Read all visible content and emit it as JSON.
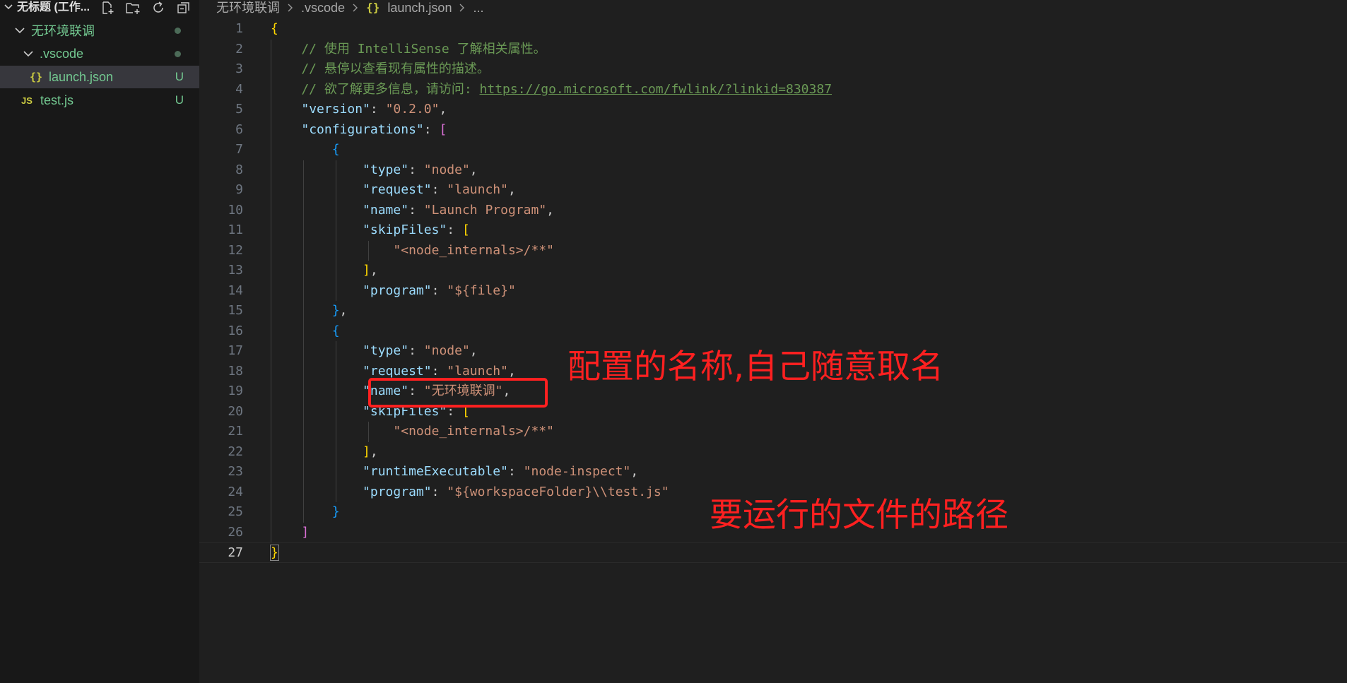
{
  "explorer": {
    "workspace_title": "无标题 (工作...",
    "actions": [
      "new-file-icon",
      "new-folder-icon",
      "refresh-icon",
      "collapse-all-icon"
    ],
    "items": [
      {
        "label": "无环境联调",
        "type": "folder",
        "status": "dot"
      },
      {
        "label": ".vscode",
        "type": "folder",
        "status": "dot"
      },
      {
        "label": "launch.json",
        "type": "json",
        "icon_text": "{}",
        "status": "U"
      },
      {
        "label": "test.js",
        "type": "js",
        "icon_text": "JS",
        "status": "U"
      }
    ]
  },
  "breadcrumb": {
    "items": [
      "无环境联调",
      ".vscode",
      "launch.json",
      "..."
    ],
    "json_icon": "{}"
  },
  "editor": {
    "active_line": 27,
    "line_numbers": [
      "1",
      "2",
      "3",
      "4",
      "5",
      "6",
      "7",
      "8",
      "9",
      "10",
      "11",
      "12",
      "13",
      "14",
      "15",
      "16",
      "17",
      "18",
      "19",
      "20",
      "21",
      "22",
      "23",
      "24",
      "25",
      "26",
      "27"
    ],
    "lines": [
      [
        [
          "br1",
          "{"
        ]
      ],
      [
        [
          "t-comment",
          "    // 使用 IntelliSense 了解相关属性。"
        ]
      ],
      [
        [
          "t-comment",
          "    // 悬停以查看现有属性的描述。"
        ]
      ],
      [
        [
          "t-comment",
          "    // 欲了解更多信息，请访问: "
        ],
        [
          "t-link",
          "https://go.microsoft.com/fwlink/?linkid=830387"
        ]
      ],
      [
        [
          "t-p",
          "    "
        ],
        [
          "t-key",
          "\"version\""
        ],
        [
          "t-p",
          ": "
        ],
        [
          "t-str",
          "\"0.2.0\""
        ],
        [
          "t-p",
          ","
        ]
      ],
      [
        [
          "t-p",
          "    "
        ],
        [
          "t-key",
          "\"configurations\""
        ],
        [
          "t-p",
          ": "
        ],
        [
          "br2",
          "["
        ]
      ],
      [
        [
          "t-p",
          "        "
        ],
        [
          "br3",
          "{"
        ]
      ],
      [
        [
          "t-p",
          "            "
        ],
        [
          "t-key",
          "\"type\""
        ],
        [
          "t-p",
          ": "
        ],
        [
          "t-str",
          "\"node\""
        ],
        [
          "t-p",
          ","
        ]
      ],
      [
        [
          "t-p",
          "            "
        ],
        [
          "t-key",
          "\"request\""
        ],
        [
          "t-p",
          ": "
        ],
        [
          "t-str",
          "\"launch\""
        ],
        [
          "t-p",
          ","
        ]
      ],
      [
        [
          "t-p",
          "            "
        ],
        [
          "t-key",
          "\"name\""
        ],
        [
          "t-p",
          ": "
        ],
        [
          "t-str",
          "\"Launch Program\""
        ],
        [
          "t-p",
          ","
        ]
      ],
      [
        [
          "t-p",
          "            "
        ],
        [
          "t-key",
          "\"skipFiles\""
        ],
        [
          "t-p",
          ": "
        ],
        [
          "br1",
          "["
        ]
      ],
      [
        [
          "t-p",
          "                "
        ],
        [
          "t-str",
          "\"<node_internals>/**\""
        ]
      ],
      [
        [
          "t-p",
          "            "
        ],
        [
          "br1",
          "]"
        ],
        [
          "t-p",
          ","
        ]
      ],
      [
        [
          "t-p",
          "            "
        ],
        [
          "t-key",
          "\"program\""
        ],
        [
          "t-p",
          ": "
        ],
        [
          "t-str",
          "\"${file}\""
        ]
      ],
      [
        [
          "t-p",
          "        "
        ],
        [
          "br3",
          "}"
        ],
        [
          "t-p",
          ","
        ]
      ],
      [
        [
          "t-p",
          "        "
        ],
        [
          "br3",
          "{"
        ]
      ],
      [
        [
          "t-p",
          "            "
        ],
        [
          "t-key",
          "\"type\""
        ],
        [
          "t-p",
          ": "
        ],
        [
          "t-str",
          "\"node\""
        ],
        [
          "t-p",
          ","
        ]
      ],
      [
        [
          "t-p",
          "            "
        ],
        [
          "t-key",
          "\"request\""
        ],
        [
          "t-p",
          ": "
        ],
        [
          "t-str",
          "\"launch\""
        ],
        [
          "t-p",
          ","
        ]
      ],
      [
        [
          "t-p",
          "            "
        ],
        [
          "t-key",
          "\"name\""
        ],
        [
          "t-p",
          ": "
        ],
        [
          "t-str",
          "\"无环境联调\""
        ],
        [
          "t-p",
          ","
        ]
      ],
      [
        [
          "t-p",
          "            "
        ],
        [
          "t-key",
          "\"skipFiles\""
        ],
        [
          "t-p",
          ": "
        ],
        [
          "br1",
          "["
        ]
      ],
      [
        [
          "t-p",
          "                "
        ],
        [
          "t-str",
          "\"<node_internals>/**\""
        ]
      ],
      [
        [
          "t-p",
          "            "
        ],
        [
          "br1",
          "]"
        ],
        [
          "t-p",
          ","
        ]
      ],
      [
        [
          "t-p",
          "            "
        ],
        [
          "t-key",
          "\"runtimeExecutable\""
        ],
        [
          "t-p",
          ": "
        ],
        [
          "t-str",
          "\"node-inspect\""
        ],
        [
          "t-p",
          ","
        ]
      ],
      [
        [
          "t-p",
          "            "
        ],
        [
          "t-key",
          "\"program\""
        ],
        [
          "t-p",
          ": "
        ],
        [
          "t-str",
          "\"${workspaceFolder}\\\\test.js\""
        ]
      ],
      [
        [
          "t-p",
          "        "
        ],
        [
          "br3",
          "}"
        ]
      ],
      [
        [
          "t-p",
          "    "
        ],
        [
          "br2",
          "]"
        ]
      ],
      [
        [
          "br1",
          "}"
        ]
      ]
    ]
  },
  "annotations": {
    "name_note": "配置的名称,自己随意取名",
    "path_note": "要运行的文件的路径",
    "color": "#ff2020"
  }
}
